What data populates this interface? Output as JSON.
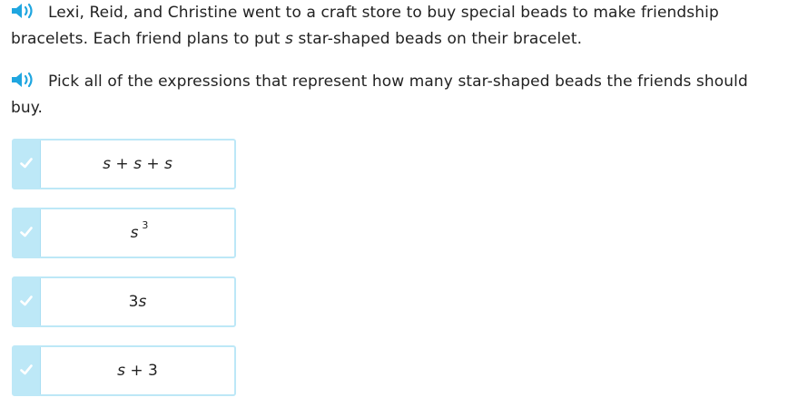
{
  "question": {
    "intro": {
      "speaker_icon": "speaker-icon",
      "text_before_var": "Lexi, Reid, and Christine went to a craft store to buy special beads to make friendship bracelets. Each friend plans to put ",
      "variable": "s",
      "text_after_var": " star-shaped beads on their bracelet."
    },
    "prompt": {
      "speaker_icon": "speaker-icon",
      "text": "Pick all of the expressions that represent how many star-shaped beads the friends should buy."
    }
  },
  "choices": [
    {
      "id": "c1",
      "var_a": "s",
      "op_a": " + ",
      "var_b": "s",
      "op_b": " + ",
      "var_c": "s",
      "selected": false
    },
    {
      "id": "c2",
      "base": "s",
      "exponent": "3",
      "selected": false
    },
    {
      "id": "c3",
      "coefficient": "3",
      "var": "s",
      "selected": false
    },
    {
      "id": "c4",
      "var": "s",
      "op": " + ",
      "const": "3",
      "selected": false
    }
  ],
  "colors": {
    "accent": "#1fa6e0",
    "choice_border": "#bde8f7",
    "check_bg": "#bde8f7",
    "check_mark": "#ffffff",
    "text": "#222222"
  }
}
